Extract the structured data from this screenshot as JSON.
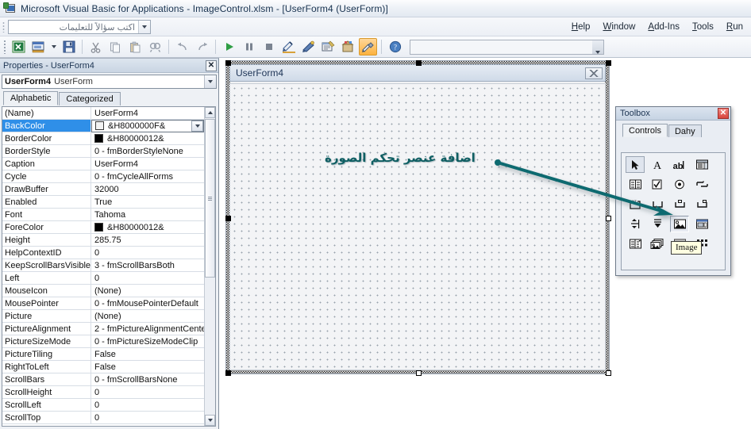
{
  "window": {
    "title": "Microsoft Visual Basic for Applications - ImageControl.xlsm - [UserForm4 (UserForm)]",
    "app_icon": "vba-excel-icon"
  },
  "menu": {
    "ask_box_placeholder": "اكتب سؤالاً للتعليمات",
    "ask_box_value": "",
    "items": [
      {
        "label": "Help"
      },
      {
        "label": "Window"
      },
      {
        "label": "Add-Ins"
      },
      {
        "label": "Tools"
      },
      {
        "label": "Run"
      }
    ]
  },
  "toolbar": {
    "buttons": [
      {
        "name": "view-excel",
        "tip": "View Microsoft Excel"
      },
      {
        "name": "insert-userform",
        "tip": "Insert UserForm"
      },
      {
        "name": "save",
        "tip": "Save ImageControl.xlsm"
      },
      {
        "name": "cut",
        "tip": "Cut"
      },
      {
        "name": "copy",
        "tip": "Copy"
      },
      {
        "name": "paste",
        "tip": "Paste"
      },
      {
        "name": "find",
        "tip": "Find"
      },
      {
        "name": "undo",
        "tip": "Undo"
      },
      {
        "name": "redo",
        "tip": "Redo"
      },
      {
        "name": "run",
        "tip": "Run Sub/UserForm"
      },
      {
        "name": "break",
        "tip": "Break"
      },
      {
        "name": "reset",
        "tip": "Reset"
      },
      {
        "name": "design-mode",
        "tip": "Design Mode"
      },
      {
        "name": "project-explorer",
        "tip": "Project Explorer"
      },
      {
        "name": "properties-window",
        "tip": "Properties Window"
      },
      {
        "name": "object-browser",
        "tip": "Object Browser"
      },
      {
        "name": "toolbox",
        "tip": "Toolbox",
        "active": true
      },
      {
        "name": "help",
        "tip": "Microsoft Visual Basic for Applications Help"
      }
    ],
    "position_box_value": ""
  },
  "properties": {
    "title": "Properties - UserForm4",
    "close_label": "✕",
    "object_name": "UserForm4",
    "object_type": "UserForm",
    "tabs": [
      {
        "label": "Alphabetic",
        "selected": true
      },
      {
        "label": "Categorized",
        "selected": false
      }
    ],
    "rows": [
      {
        "name": "(Name)",
        "value": "UserForm4"
      },
      {
        "name": "BackColor",
        "value": "&H8000000F&",
        "swatch": "#f2f2f2",
        "selected": true,
        "dropdown": true
      },
      {
        "name": "BorderColor",
        "value": "&H80000012&",
        "swatch": "#000000"
      },
      {
        "name": "BorderStyle",
        "value": "0 - fmBorderStyleNone"
      },
      {
        "name": "Caption",
        "value": "UserForm4"
      },
      {
        "name": "Cycle",
        "value": "0 - fmCycleAllForms"
      },
      {
        "name": "DrawBuffer",
        "value": "32000"
      },
      {
        "name": "Enabled",
        "value": "True"
      },
      {
        "name": "Font",
        "value": "Tahoma"
      },
      {
        "name": "ForeColor",
        "value": "&H80000012&",
        "swatch": "#000000"
      },
      {
        "name": "Height",
        "value": "285.75"
      },
      {
        "name": "HelpContextID",
        "value": "0"
      },
      {
        "name": "KeepScrollBarsVisible",
        "value": "3 - fmScrollBarsBoth"
      },
      {
        "name": "Left",
        "value": "0"
      },
      {
        "name": "MouseIcon",
        "value": "(None)"
      },
      {
        "name": "MousePointer",
        "value": "0 - fmMousePointerDefault"
      },
      {
        "name": "Picture",
        "value": "(None)"
      },
      {
        "name": "PictureAlignment",
        "value": "2 - fmPictureAlignmentCenter"
      },
      {
        "name": "PictureSizeMode",
        "value": "0 - fmPictureSizeModeClip"
      },
      {
        "name": "PictureTiling",
        "value": "False"
      },
      {
        "name": "RightToLeft",
        "value": "False"
      },
      {
        "name": "ScrollBars",
        "value": "0 - fmScrollBarsNone"
      },
      {
        "name": "ScrollHeight",
        "value": "0"
      },
      {
        "name": "ScrollLeft",
        "value": "0"
      },
      {
        "name": "ScrollTop",
        "value": "0"
      }
    ]
  },
  "form_designer": {
    "caption": "UserForm4",
    "close_label": "✕",
    "annotation": "اضافة عنصر تحكم الصورة"
  },
  "toolbox": {
    "title": "Toolbox",
    "close_label": "✕",
    "tabs": [
      {
        "label": "Controls",
        "selected": true
      },
      {
        "label": "Dahy",
        "selected": false
      }
    ],
    "tooltip": "Image",
    "controls": [
      {
        "name": "select-objects-icon",
        "selected": true
      },
      {
        "name": "label-icon",
        "selected": false
      },
      {
        "name": "textbox-icon",
        "selected": false
      },
      {
        "name": "combobox-icon",
        "selected": false
      },
      {
        "name": "listbox-icon",
        "selected": false
      },
      {
        "name": "checkbox-icon",
        "selected": false
      },
      {
        "name": "optionbutton-icon",
        "selected": false
      },
      {
        "name": "togglebutton-icon",
        "selected": false
      },
      {
        "name": "frame-icon",
        "selected": false
      },
      {
        "name": "commandbutton-icon",
        "selected": false
      },
      {
        "name": "tabstrip-icon",
        "selected": false
      },
      {
        "name": "multipage-icon",
        "selected": false
      },
      {
        "name": "scrollbar-icon",
        "selected": false
      },
      {
        "name": "spinbutton-icon",
        "selected": false
      },
      {
        "name": "image-icon",
        "selected": true
      },
      {
        "name": "refedit-icon",
        "selected": false
      },
      {
        "name": "listview-icon",
        "selected": false
      },
      {
        "name": "multipage2-icon",
        "selected": false
      },
      {
        "name": "hatch-icon",
        "selected": false
      },
      {
        "name": "morecontrols-icon",
        "selected": false
      }
    ]
  },
  "colors": {
    "accent_teal": "#0f6b70",
    "selection_blue": "#2f8fe8",
    "toolbar_active": "#fcb23f"
  }
}
